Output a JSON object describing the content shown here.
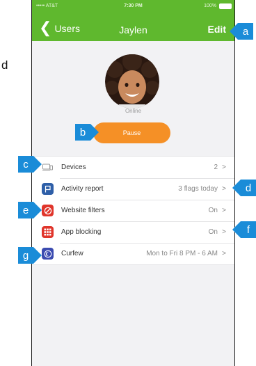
{
  "side_text": "d",
  "status_bar": {
    "carrier": "••••• AT&T",
    "time": "7:30 PM",
    "battery": "100%"
  },
  "nav": {
    "back_label": "Users",
    "title": "Jaylen",
    "edit_label": "Edit"
  },
  "profile": {
    "status": "Online",
    "pause_label": "Pause"
  },
  "menu": {
    "items": [
      {
        "label": "Devices",
        "value": "2",
        "icon": "devices-icon"
      },
      {
        "label": "Activity report",
        "value": "3 flags today",
        "icon": "flag-icon"
      },
      {
        "label": "Website filters",
        "value": "On",
        "icon": "block-icon"
      },
      {
        "label": "App blocking",
        "value": "On",
        "icon": "app-grid-icon"
      },
      {
        "label": "Curfew",
        "value": "Mon to Fri 8 PM - 6 AM",
        "icon": "moon-icon"
      }
    ]
  },
  "callouts": [
    "a",
    "b",
    "c",
    "d",
    "e",
    "f",
    "g"
  ],
  "colors": {
    "header": "#5fb82e",
    "pause": "#f59026",
    "callout": "#1a8cd8",
    "flag": "#2e5fa8",
    "filter": "#e0352b",
    "app": "#e0352b",
    "curfew": "#3b4bb0"
  }
}
